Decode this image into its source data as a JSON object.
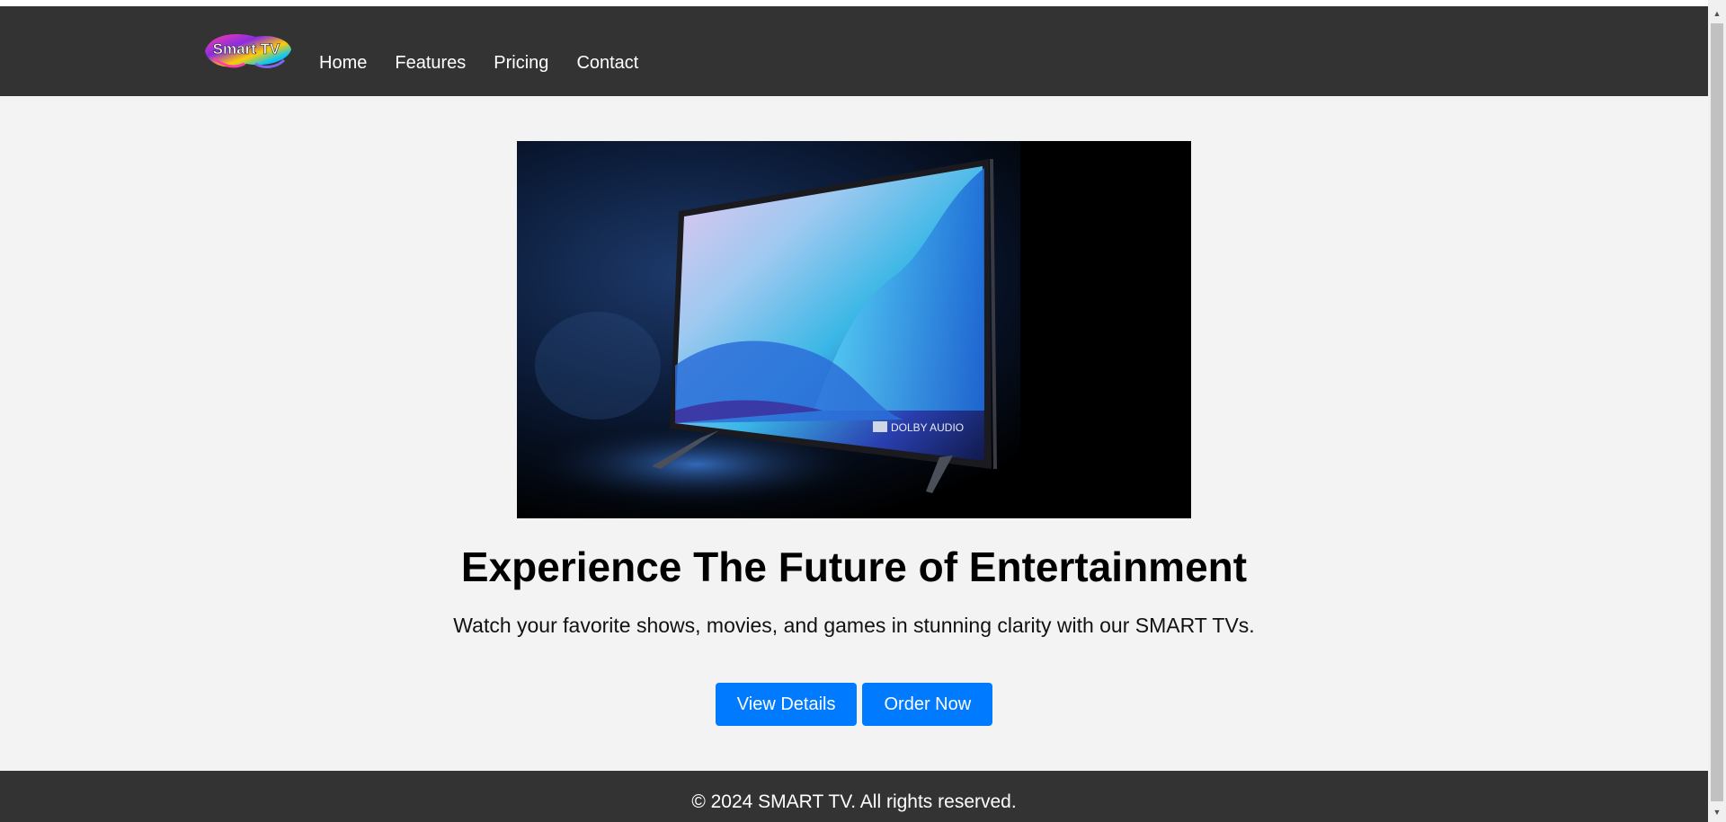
{
  "brand": {
    "logo_text": "Smart TV"
  },
  "nav": {
    "items": [
      {
        "label": "Home"
      },
      {
        "label": "Features"
      },
      {
        "label": "Pricing"
      },
      {
        "label": "Contact"
      }
    ]
  },
  "hero": {
    "image_badge": "DOLBY AUDIO",
    "title": "Experience The Future of Entertainment",
    "subtitle": "Watch your favorite shows, movies, and games in stunning clarity with our SMART TVs.",
    "buttons": {
      "view_details": "View Details",
      "order_now": "Order Now"
    }
  },
  "footer": {
    "text": "© 2024 SMART TV. All rights reserved."
  },
  "colors": {
    "header_bg": "#333333",
    "page_bg": "#f3f3f3",
    "button_bg": "#007bff",
    "button_text": "#ffffff"
  },
  "scrollbar": {
    "up_icon": "scroll-up-arrow-icon",
    "down_icon": "scroll-down-arrow-icon"
  }
}
